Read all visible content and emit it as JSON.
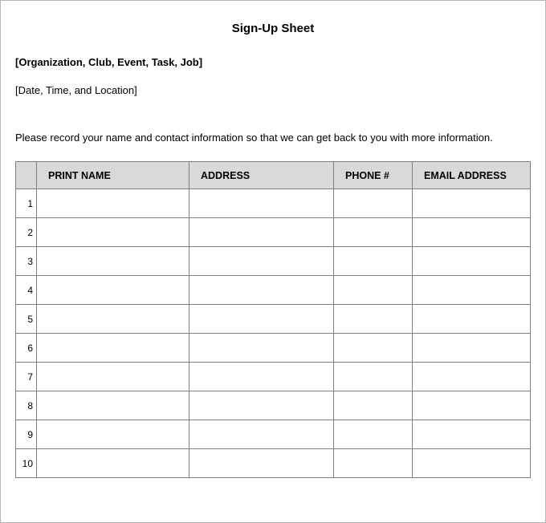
{
  "title": "Sign-Up Sheet",
  "org_placeholder": "[Organization, Club, Event, Task, Job]",
  "date_placeholder": "[Date, Time, and Location]",
  "instruction": "Please record your name and contact information so that we can get back to you with more information.",
  "columns": {
    "name": "PRINT NAME",
    "address": "ADDRESS",
    "phone": "PHONE #",
    "email": "EMAIL ADDRESS"
  },
  "rows": [
    {
      "num": "1",
      "name": "",
      "address": "",
      "phone": "",
      "email": ""
    },
    {
      "num": "2",
      "name": "",
      "address": "",
      "phone": "",
      "email": ""
    },
    {
      "num": "3",
      "name": "",
      "address": "",
      "phone": "",
      "email": ""
    },
    {
      "num": "4",
      "name": "",
      "address": "",
      "phone": "",
      "email": ""
    },
    {
      "num": "5",
      "name": "",
      "address": "",
      "phone": "",
      "email": ""
    },
    {
      "num": "6",
      "name": "",
      "address": "",
      "phone": "",
      "email": ""
    },
    {
      "num": "7",
      "name": "",
      "address": "",
      "phone": "",
      "email": ""
    },
    {
      "num": "8",
      "name": "",
      "address": "",
      "phone": "",
      "email": ""
    },
    {
      "num": "9",
      "name": "",
      "address": "",
      "phone": "",
      "email": ""
    },
    {
      "num": "10",
      "name": "",
      "address": "",
      "phone": "",
      "email": ""
    }
  ]
}
